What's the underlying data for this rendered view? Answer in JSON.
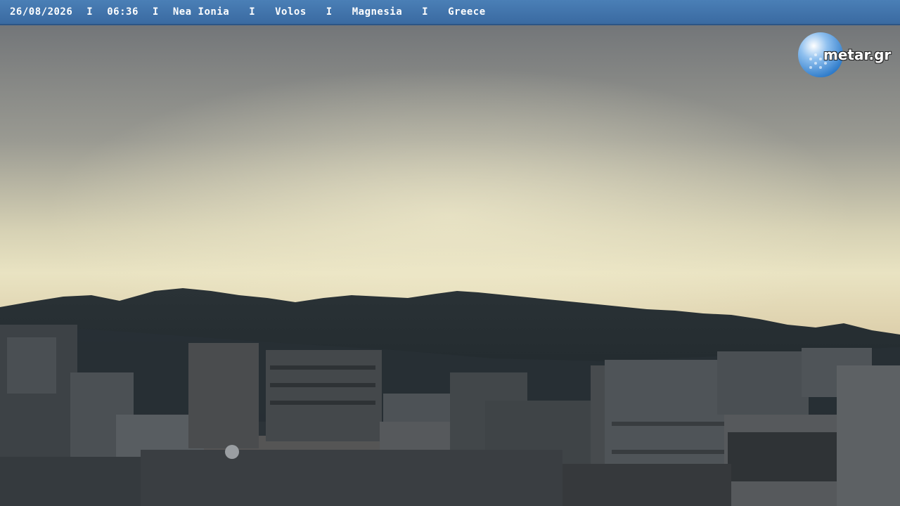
{
  "overlay": {
    "date": "26/08/2026",
    "time": "06:36",
    "place": "Nea Ionia",
    "city": "Volos",
    "region": "Magnesia",
    "country": "Greece",
    "separator": "I"
  },
  "logo": {
    "text": "metar.gr",
    "icon": "globe-icon"
  },
  "colors": {
    "bar": "#3f73aa",
    "sky_top": "#7a7d80",
    "sky_horizon": "#e6e0bf",
    "mountains": "#242c31",
    "city": "#3a4045"
  }
}
